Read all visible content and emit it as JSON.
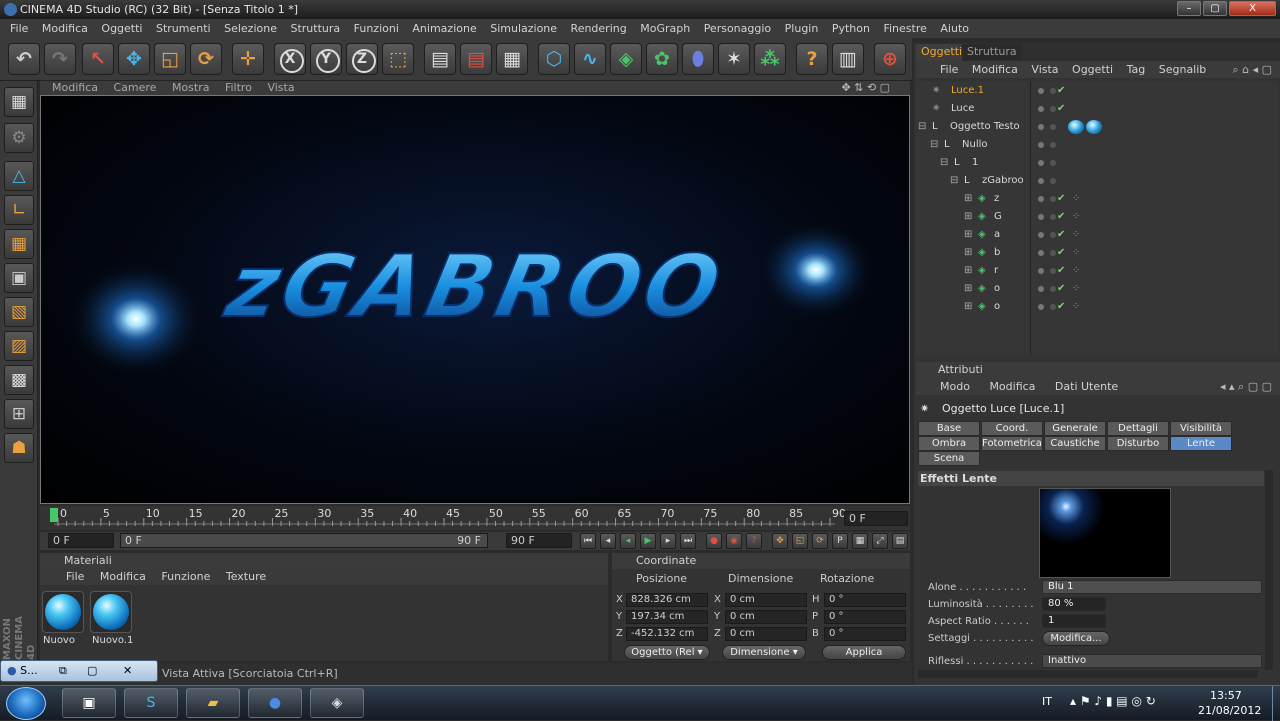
{
  "window": {
    "title": "CINEMA 4D Studio (RC) (32 Bit) - [Senza Titolo 1 *]",
    "minimize": "–",
    "restore": "▢",
    "close": "X"
  },
  "menu": [
    "File",
    "Modifica",
    "Oggetti",
    "Strumenti",
    "Selezione",
    "Struttura",
    "Funzioni",
    "Animazione",
    "Simulazione",
    "Rendering",
    "MoGraph",
    "Personaggio",
    "Plugin",
    "Python",
    "Finestre",
    "Aiuto"
  ],
  "toolbar": {
    "undo_icon": "undo-icon",
    "redo_icon": "redo-icon",
    "x_label": "X",
    "y_label": "Y",
    "z_label": "Z"
  },
  "viewport": {
    "menu": [
      "Modifica",
      "Camere",
      "Mostra",
      "Filtro",
      "Vista"
    ],
    "text3d": "zGABROO"
  },
  "timeline": {
    "ticks": [
      "0",
      "5",
      "10",
      "15",
      "20",
      "25",
      "30",
      "35",
      "40",
      "45",
      "50",
      "55",
      "60",
      "65",
      "70",
      "75",
      "80",
      "85",
      "90"
    ],
    "current_frame": "0 F",
    "start": "0 F",
    "range_start": "0 F",
    "range_end": "90 F",
    "end": "90 F"
  },
  "materials": {
    "header": "Materiali",
    "menu": [
      "File",
      "Modifica",
      "Funzione",
      "Texture"
    ],
    "items": [
      "Nuovo",
      "Nuovo.1"
    ]
  },
  "coordinates": {
    "header": "Coordinate",
    "col_headers": [
      "Posizione",
      "Dimensione",
      "Rotazione"
    ],
    "rows": [
      {
        "axis": "X",
        "pos": "828.326 cm",
        "dimlbl": "X",
        "dim": "0 cm",
        "rotlbl": "H",
        "rot": "0 °"
      },
      {
        "axis": "Y",
        "pos": "197.34 cm",
        "dimlbl": "Y",
        "dim": "0 cm",
        "rotlbl": "P",
        "rot": "0 °"
      },
      {
        "axis": "Z",
        "pos": "-452.132 cm",
        "dimlbl": "Z",
        "dim": "0 cm",
        "rotlbl": "B",
        "rot": "0 °"
      }
    ],
    "mode_dropdown": "Oggetto (Rel",
    "size_dropdown": "Dimensione",
    "apply": "Applica"
  },
  "statusbar": {
    "text": "za Vista Attiva [Scorciatoia Ctrl+R]",
    "popup_label": "S..."
  },
  "object_manager": {
    "tabs": [
      "Oggetti",
      "Struttura"
    ],
    "menu": [
      "File",
      "Modifica",
      "Vista",
      "Oggetti",
      "Tag",
      "Segnalib"
    ],
    "objects": [
      {
        "name": "Luce.1",
        "indent": 0,
        "selected": true,
        "check": true,
        "tag": false
      },
      {
        "name": "Luce",
        "indent": 0,
        "selected": false,
        "check": true,
        "tag": false
      },
      {
        "name": "Oggetto Testo",
        "indent": 0,
        "selected": false,
        "check": false,
        "tag": true
      },
      {
        "name": "Nullo",
        "indent": 1,
        "selected": false,
        "check": false,
        "tag": false
      },
      {
        "name": "1",
        "indent": 2,
        "selected": false,
        "check": false,
        "tag": false
      },
      {
        "name": "zGabroo",
        "indent": 3,
        "selected": false,
        "check": false,
        "tag": false
      },
      {
        "name": "z",
        "indent": 4,
        "selected": false,
        "check": true,
        "tag": true
      },
      {
        "name": "G",
        "indent": 4,
        "selected": false,
        "check": true,
        "tag": true
      },
      {
        "name": "a",
        "indent": 4,
        "selected": false,
        "check": true,
        "tag": true
      },
      {
        "name": "b",
        "indent": 4,
        "selected": false,
        "check": true,
        "tag": true
      },
      {
        "name": "r",
        "indent": 4,
        "selected": false,
        "check": true,
        "tag": true
      },
      {
        "name": "o",
        "indent": 4,
        "selected": false,
        "check": true,
        "tag": true
      },
      {
        "name": "o",
        "indent": 4,
        "selected": false,
        "check": true,
        "tag": true
      }
    ]
  },
  "attributes": {
    "header": "Attributi",
    "menu": [
      "Modo",
      "Modifica",
      "Dati Utente"
    ],
    "title": "Oggetto Luce [Luce.1]",
    "tabs": [
      "Base",
      "Coord.",
      "Generale",
      "Dettagli",
      "Visibilità",
      "Ombra",
      "Fotometrica",
      "Caustiche",
      "Disturbo",
      "Lente",
      "Scena"
    ],
    "active_tab": "Lente",
    "section": "Effetti Lente",
    "props": [
      {
        "label": "Alone . . . . . . . . . . .",
        "value": "Blu 1"
      },
      {
        "label": "Luminosità . . . . . . . .",
        "value": "80 %"
      },
      {
        "label": "Aspect Ratio . . . . . .",
        "value": "1"
      },
      {
        "label": "Settaggi . . . . . . . . . .",
        "value": "Modifica..."
      },
      {
        "label": "Riflessi . . . . . . . . . . .",
        "value": "Inattivo"
      }
    ]
  },
  "taskbar": {
    "lang": "IT",
    "time": "13:57",
    "date": "21/08/2012"
  }
}
